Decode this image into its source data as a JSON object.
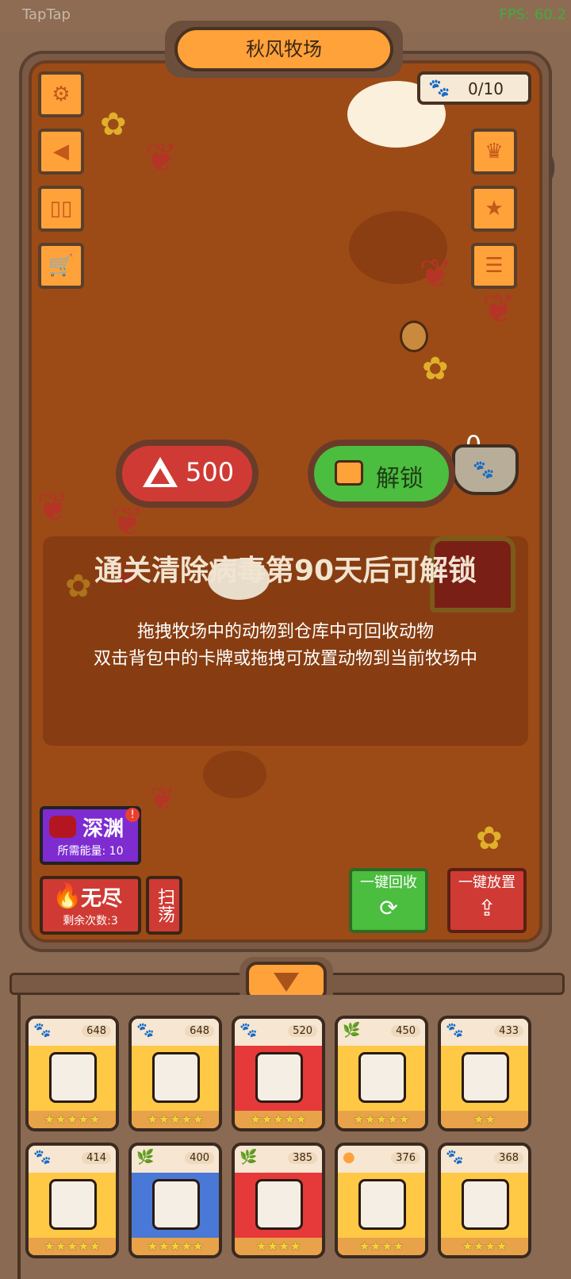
{
  "system": {
    "app_tag": "TapTap",
    "fps": "FPS: 60.2"
  },
  "farm": {
    "title": "秋风牧场",
    "capacity": "0/10",
    "bowl_count": "0",
    "cost_value": "500",
    "unlock_label": "解锁",
    "lock_message": "通关清除病毒第90天后可解锁",
    "tips": [
      "拖拽牧场中的动物到仓库中可回收动物",
      "双击背包中的卡牌或拖拽可放置动物到当前牧场中"
    ]
  },
  "side_left": [
    "gear-icon",
    "speaker-icon",
    "book-icon",
    "cart-icon"
  ],
  "side_right": [
    "crown-icon",
    "star-icon",
    "clipboard-icon"
  ],
  "modes": {
    "abyss_label": "深渊",
    "abyss_sub": "所需能量: 10",
    "abyss_badge": "!",
    "endless_label": "无尽",
    "endless_sub": "剩余次数:3",
    "sweep_label": "扫荡"
  },
  "actions": {
    "recycle_label": "一键回收",
    "place_label": "一键放置"
  },
  "inventory": [
    {
      "power": "648",
      "type": "paw",
      "color": "#ffc845",
      "stars": "★★★★★"
    },
    {
      "power": "648",
      "type": "paw",
      "color": "#ffc845",
      "stars": "★★★★★"
    },
    {
      "power": "520",
      "type": "paw",
      "color": "#e63a3a",
      "stars": "★★★★★"
    },
    {
      "power": "450",
      "type": "leaf",
      "color": "#ffc845",
      "stars": "★★★★★"
    },
    {
      "power": "433",
      "type": "paw",
      "color": "#ffc845",
      "stars": "★★"
    },
    {
      "power": "414",
      "type": "paw",
      "color": "#ffc845",
      "stars": "★★★★★"
    },
    {
      "power": "400",
      "type": "leaf",
      "color": "#4a78d6",
      "stars": "★★★★★"
    },
    {
      "power": "385",
      "type": "leaf",
      "color": "#e63a3a",
      "stars": "★★★★"
    },
    {
      "power": "376",
      "type": "egg",
      "color": "#ffc845",
      "stars": "★★★★"
    },
    {
      "power": "368",
      "type": "paw",
      "color": "#ffc845",
      "stars": "★★★★"
    }
  ]
}
